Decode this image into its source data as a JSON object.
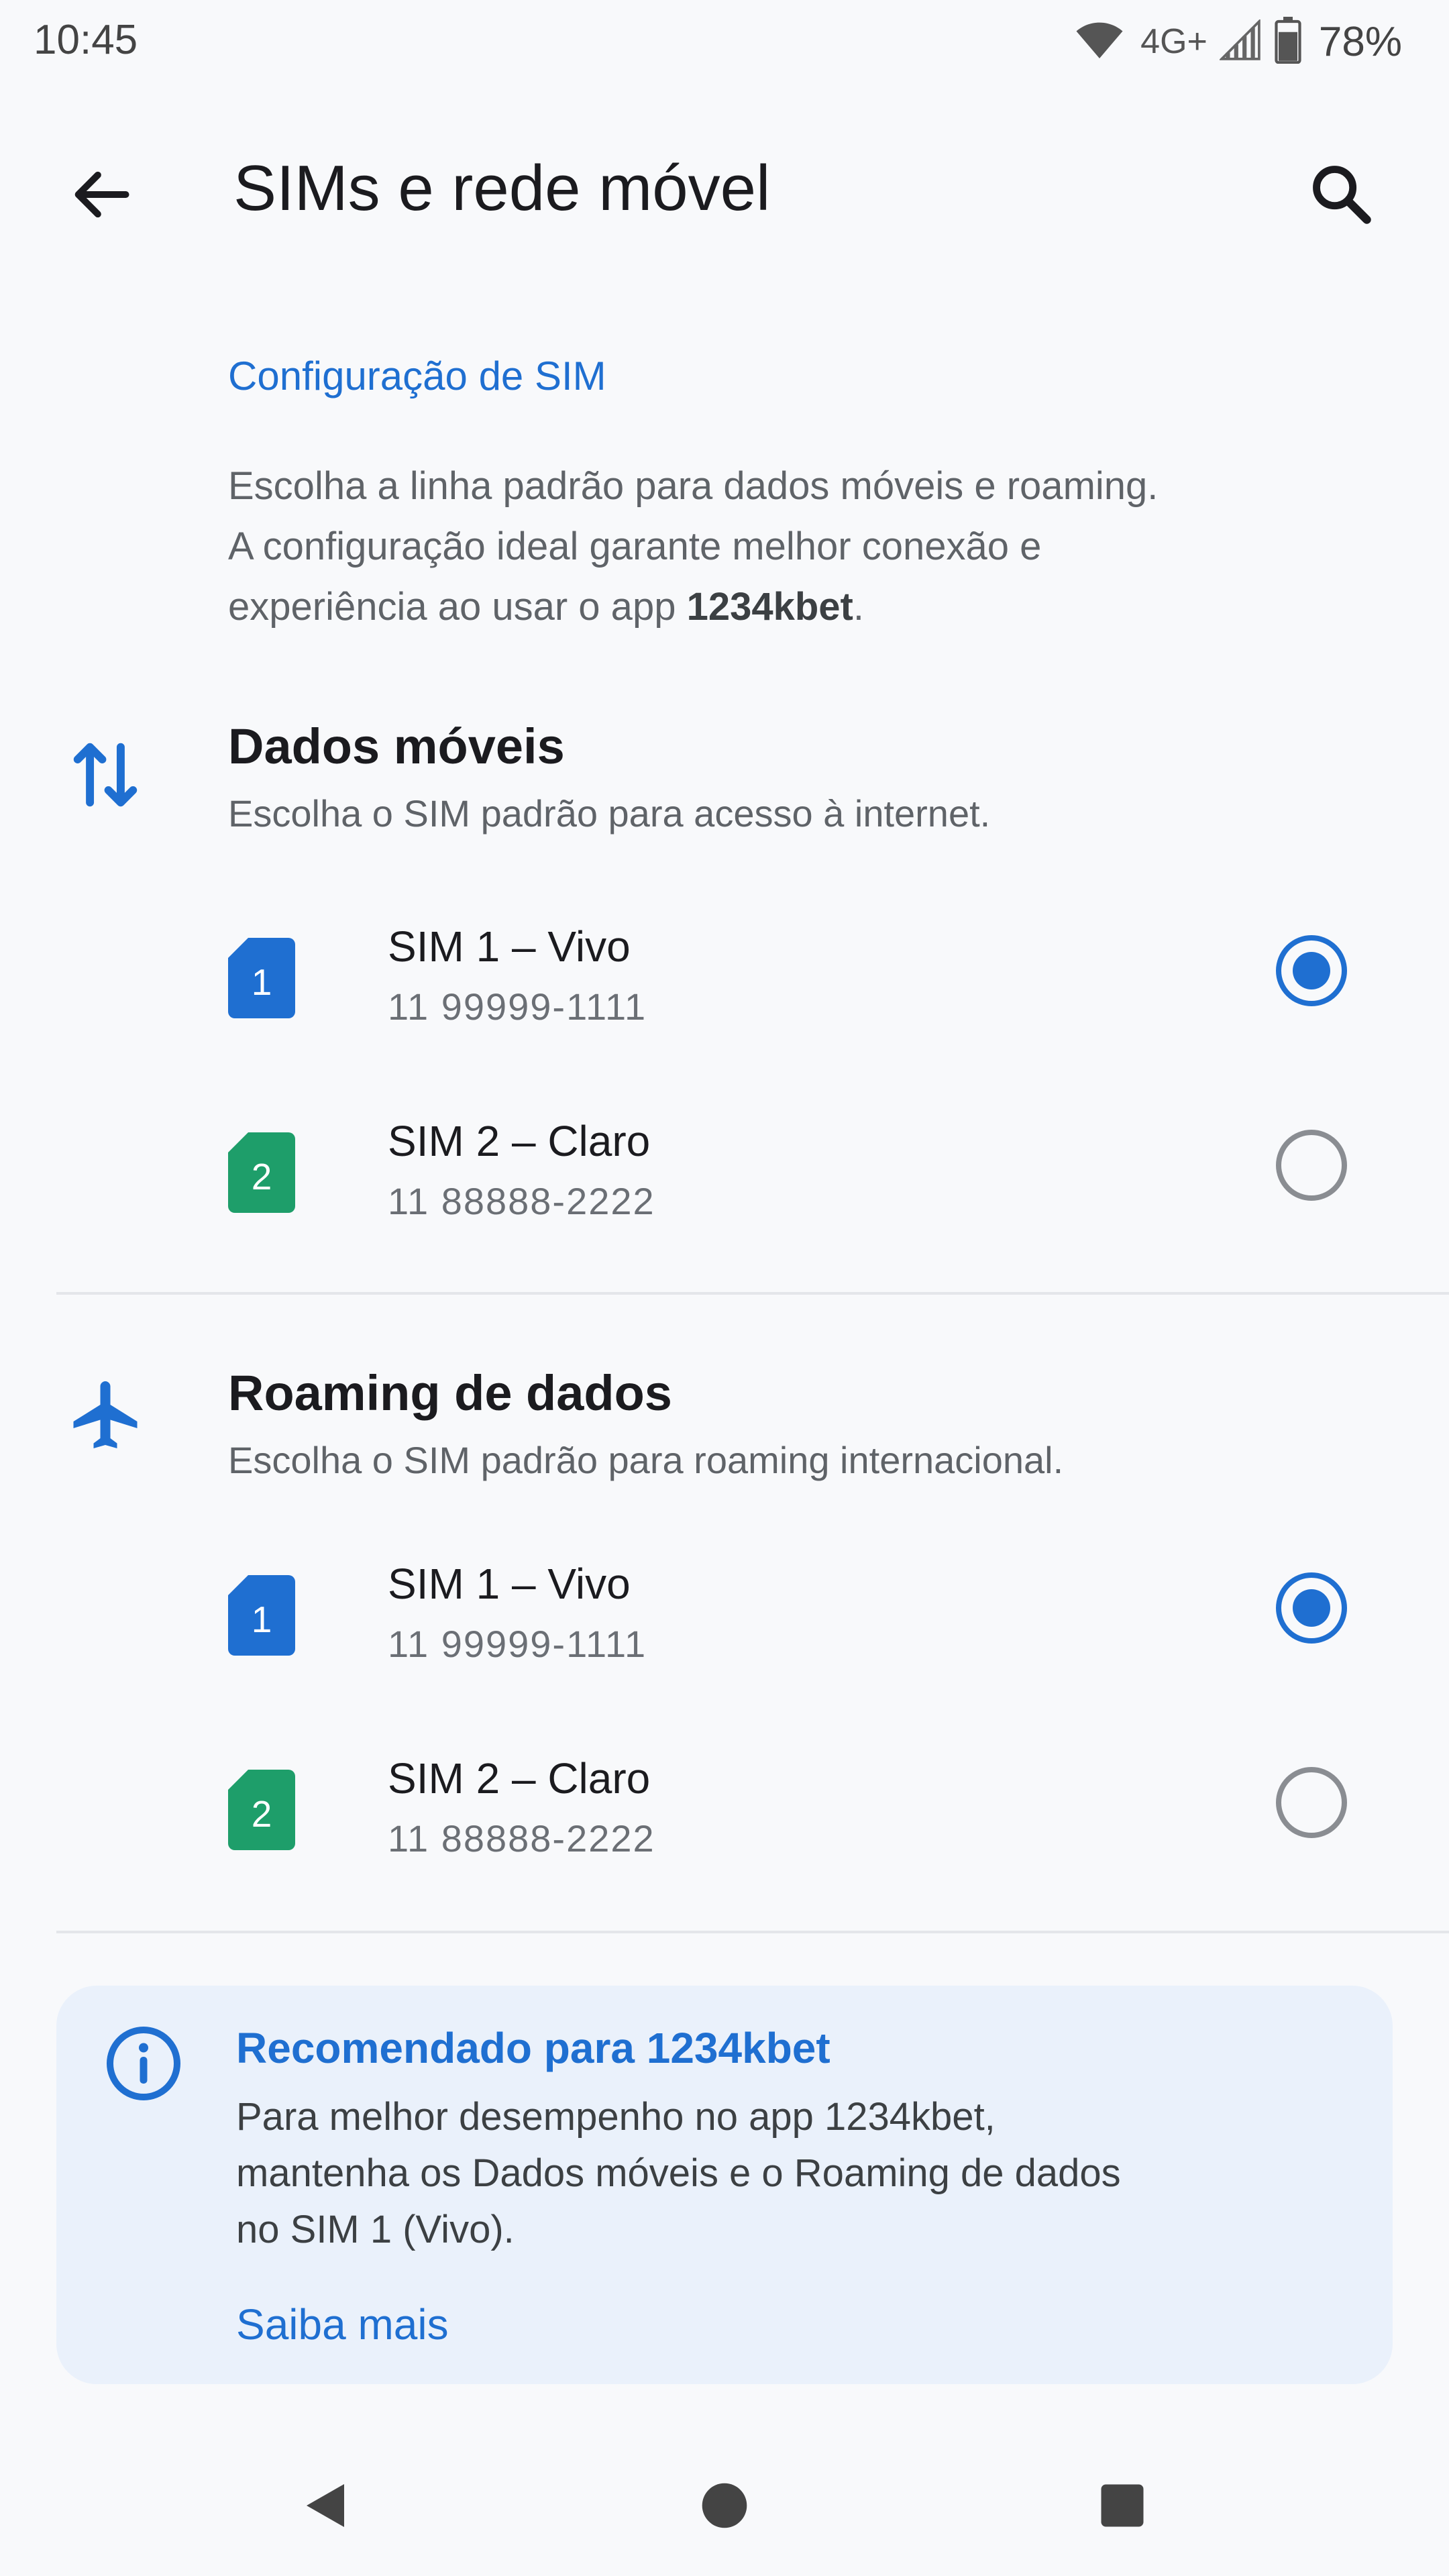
{
  "status_bar": {
    "time": "10:45",
    "network": "4G+",
    "battery": "78%"
  },
  "app_bar": {
    "title": "SIMs e rede móvel"
  },
  "section": {
    "heading": "Configuração de SIM",
    "intro_line1": "Escolha a linha padrão para dados móveis e roaming.",
    "intro_line2": "A configuração ideal garante melhor conexão e",
    "intro_line3_pre": "experiência ao usar o app ",
    "intro_app": "1234kbet",
    "intro_line3_post": "."
  },
  "mobile_data": {
    "title": "Dados móveis",
    "subtitle": "Escolha o SIM padrão para acesso à internet.",
    "sims": [
      {
        "badge": "1",
        "name": "SIM 1 – Vivo",
        "number": "11 99999-1111",
        "selected": true,
        "color": "#1f6fd1"
      },
      {
        "badge": "2",
        "name": "SIM 2 – Claro",
        "number": "11 88888-2222",
        "selected": false,
        "color": "#1e9e6a"
      }
    ]
  },
  "roaming": {
    "title": "Roaming de dados",
    "subtitle": "Escolha o SIM padrão para roaming internacional.",
    "sims": [
      {
        "badge": "1",
        "name": "SIM 1 – Vivo",
        "number": "11 99999-1111",
        "selected": true,
        "color": "#1f6fd1"
      },
      {
        "badge": "2",
        "name": "SIM 2 – Claro",
        "number": "11 88888-2222",
        "selected": false,
        "color": "#1e9e6a"
      }
    ]
  },
  "info_card": {
    "title": "Recomendado para 1234kbet",
    "body_line1": "Para melhor desempenho no app 1234kbet,",
    "body_line2": "mantenha os Dados móveis e o Roaming de dados",
    "body_line3": "no SIM 1 (Vivo).",
    "link": "Saiba mais"
  },
  "colors": {
    "accent": "#1f6fd1",
    "sim2": "#1e9e6a",
    "card_bg": "#eaf1fb"
  },
  "icons": [
    "back-arrow-icon",
    "search-icon",
    "swap-vertical-icon",
    "airplane-icon",
    "sim-card-icon",
    "info-icon",
    "wifi-icon",
    "signal-icon",
    "battery-icon",
    "nav-back-icon",
    "nav-home-icon",
    "nav-recents-icon"
  ]
}
